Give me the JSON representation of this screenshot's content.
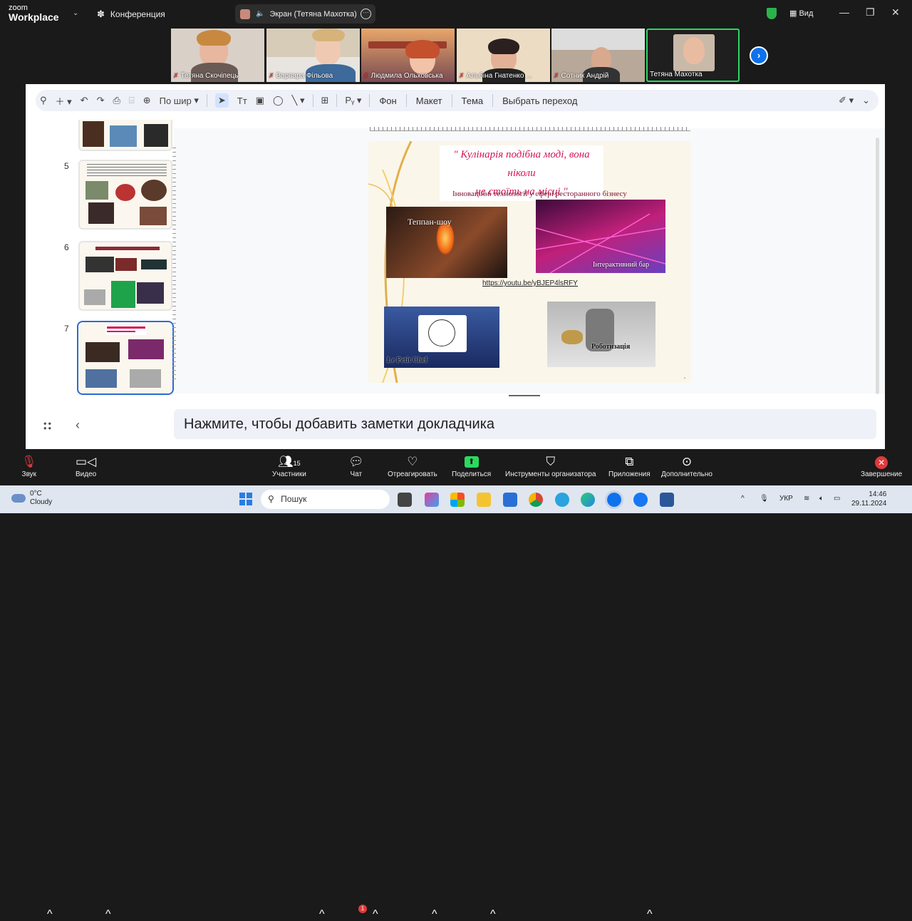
{
  "app": {
    "brand_top": "zoom",
    "brand_bottom": "Workplace",
    "meeting_label": "Конференция"
  },
  "screen_pill": {
    "label": "Экран (Тетяна Махотка)"
  },
  "topbar": {
    "view_label": "Вид"
  },
  "participants": [
    {
      "name": "Тетяна Скочіпець",
      "muted": true
    },
    {
      "name": "Варвара Фільова",
      "muted": true
    },
    {
      "name": "Людмила Ольховська",
      "muted": true
    },
    {
      "name": "Альбіна Гнатенко ...",
      "muted": true
    },
    {
      "name": "Сотник Андрій",
      "muted": true
    },
    {
      "name": "Тетяна Махотка",
      "muted": false
    }
  ],
  "slides_toolbar": {
    "zoom_label": "По шир",
    "background": "Фон",
    "layout": "Макет",
    "theme": "Тема",
    "transition": "Выбрать переход"
  },
  "slide_list": [
    {
      "number": ""
    },
    {
      "number": "5"
    },
    {
      "number": "6"
    },
    {
      "number": "7",
      "selected": true
    }
  ],
  "slide": {
    "title_line1": "\" Кулінарія подібна моді, вона ніколи",
    "title_line2": "не стоїть на місці \"",
    "subtitle": "Інноваційні технології у сфері ресторанного бізнесу",
    "pic1_caption": "Теппан-шоу",
    "pic2_caption": "Інтерактивний бар",
    "link": "https://youtu.be/yBJEP4lsRFY",
    "pic3_caption": "Le Petit Chef",
    "pic4_caption": "Роботизація"
  },
  "notes": {
    "placeholder": "Нажмите, чтобы добавить заметки докладчика"
  },
  "controls": {
    "audio": "Звук",
    "video": "Видео",
    "participants": "Участники",
    "participants_count": "15",
    "chat": "Чат",
    "chat_badge": "1",
    "react": "Отреагировать",
    "share": "Поделиться",
    "host_tools": "Инструменты организатора",
    "apps": "Приложения",
    "more": "Дополнительно",
    "end": "Завершение"
  },
  "taskbar": {
    "temp": "0°C",
    "weather": "Cloudy",
    "search_placeholder": "Пошук",
    "lang": "УКР",
    "time": "14:46",
    "date": "29.11.2024"
  },
  "colors": {
    "zoom_blue": "#0e72ed",
    "active_green": "#2bd860",
    "danger_red": "#e03a3a",
    "slide_title": "#d4145a"
  }
}
